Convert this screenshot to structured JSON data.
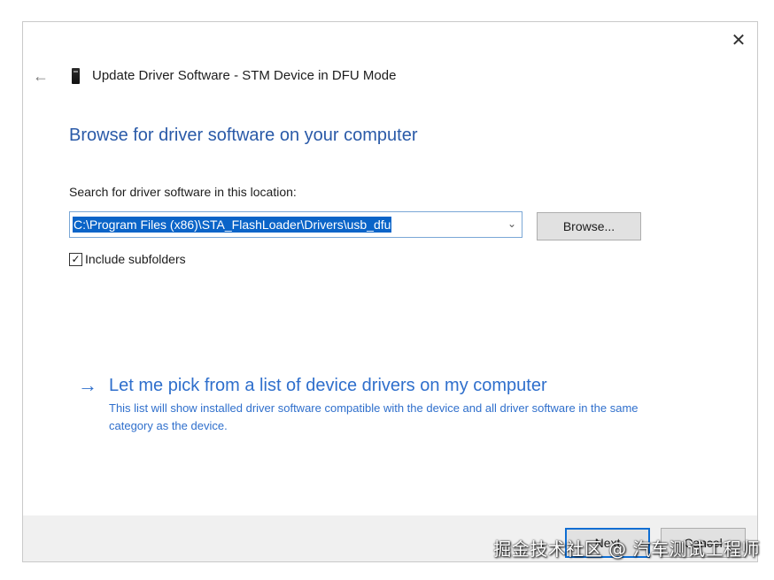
{
  "window": {
    "title": "Update Driver Software - STM Device in DFU Mode",
    "close_glyph": "✕",
    "back_glyph": "←"
  },
  "main": {
    "heading": "Browse for driver software on your computer",
    "search_label": "Search for driver software in this location:",
    "path_value": "C:\\Program Files (x86)\\STA_FlashLoader\\Drivers\\usb_dfu",
    "dropdown_glyph": "⌄",
    "browse_label": "Browse...",
    "include_subfolders": {
      "label": "Include subfolders",
      "checked": true,
      "check_glyph": "✓"
    },
    "pick_option": {
      "arrow_glyph": "→",
      "title": "Let me pick from a list of device drivers on my computer",
      "description": "This list will show installed driver software compatible with the device and all driver software in the same category as the device."
    }
  },
  "footer": {
    "next_label": "Next",
    "cancel_label": "Cancel"
  },
  "watermark": "掘金技术社区 @ 汽车测试工程师",
  "colors": {
    "accent_blue": "#2f6fcc",
    "heading_blue": "#2a5aa8",
    "selection_blue": "#0a64c8",
    "footer_bg": "#f0f0f0"
  },
  "icons": {
    "title_icon": "usb-device-icon",
    "back": "back-arrow-icon",
    "close": "close-icon",
    "dropdown": "chevron-down-icon",
    "pick": "right-arrow-icon"
  }
}
